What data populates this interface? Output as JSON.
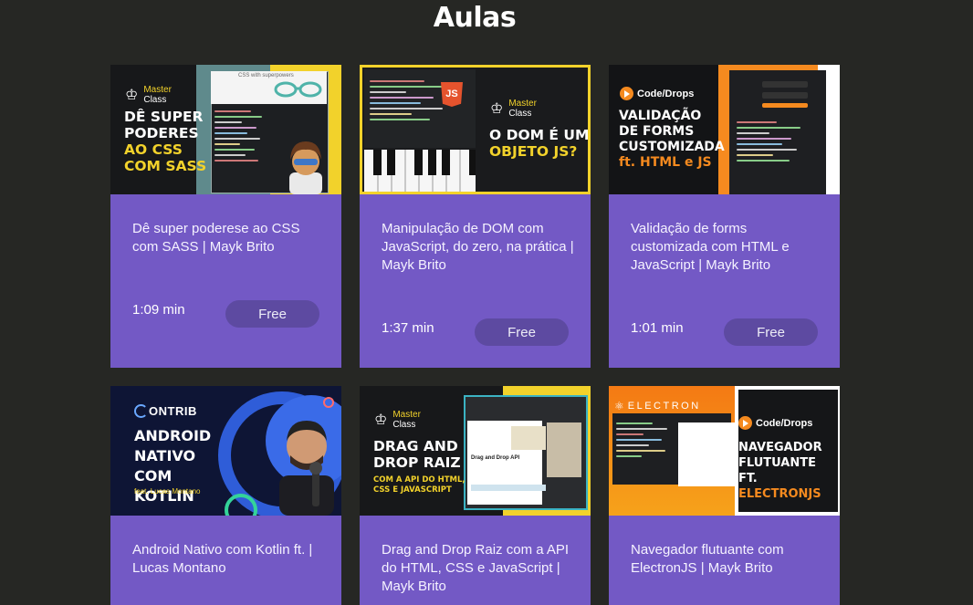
{
  "page": {
    "title": "Aulas"
  },
  "cards": [
    {
      "title": "Dê super poderese ao CSS com SASS | Mayk Brito",
      "duration": "1:09 min",
      "badge": "Free",
      "thumb": {
        "brand_top": "Master",
        "brand_bottom": "Class",
        "line1": "Dê super",
        "line2": "poderes",
        "line3": "ao CSS",
        "line4": "com SASS",
        "window_title": "CSS with superpowers"
      }
    },
    {
      "title": "Manipulação de DOM com JavaScript, do zero, na prática | Mayk Brito",
      "duration": "1:37 min",
      "badge": "Free",
      "thumb": {
        "brand_top": "Master",
        "brand_bottom": "Class",
        "line1": "O DOM é um",
        "line2": "objeto JS?",
        "js_logo": "JS"
      }
    },
    {
      "title": "Validação de forms customizada com HTML e JavaScript | Mayk Brito",
      "duration": "1:01 min",
      "badge": "Free",
      "thumb": {
        "brand": "Code/Drops",
        "line1": "Validação",
        "line2": "de forms",
        "line3": "customizada",
        "line4": "ft. HTML e JS"
      }
    },
    {
      "title": "Android Nativo com Kotlin ft. | Lucas Montano",
      "duration": "",
      "badge": "",
      "thumb": {
        "brand": "ONTRIB",
        "line1": "Android",
        "line2": "Nativo com",
        "line3": "Kotlin",
        "feat": "feat. Lucas Montano"
      }
    },
    {
      "title": "Drag and Drop Raiz com a API do HTML, CSS e JavaScript | Mayk Brito",
      "duration": "",
      "badge": "",
      "thumb": {
        "brand_top": "Master",
        "brand_bottom": "Class",
        "line1": "Drag and",
        "line2": "Drop Raiz",
        "line3": "com a API do HTML,",
        "line4": "CSS e JavaScript",
        "window_title": "Drag and Drop API"
      }
    },
    {
      "title": "Navegador flutuante com ElectronJS | Mayk Brito",
      "duration": "",
      "badge": "",
      "thumb": {
        "brand_left": "ELECTRON",
        "brand": "Code/Drops",
        "line1": "Navegador",
        "line2": "flutuante ft.",
        "line3": "ElectronJS"
      }
    }
  ]
}
